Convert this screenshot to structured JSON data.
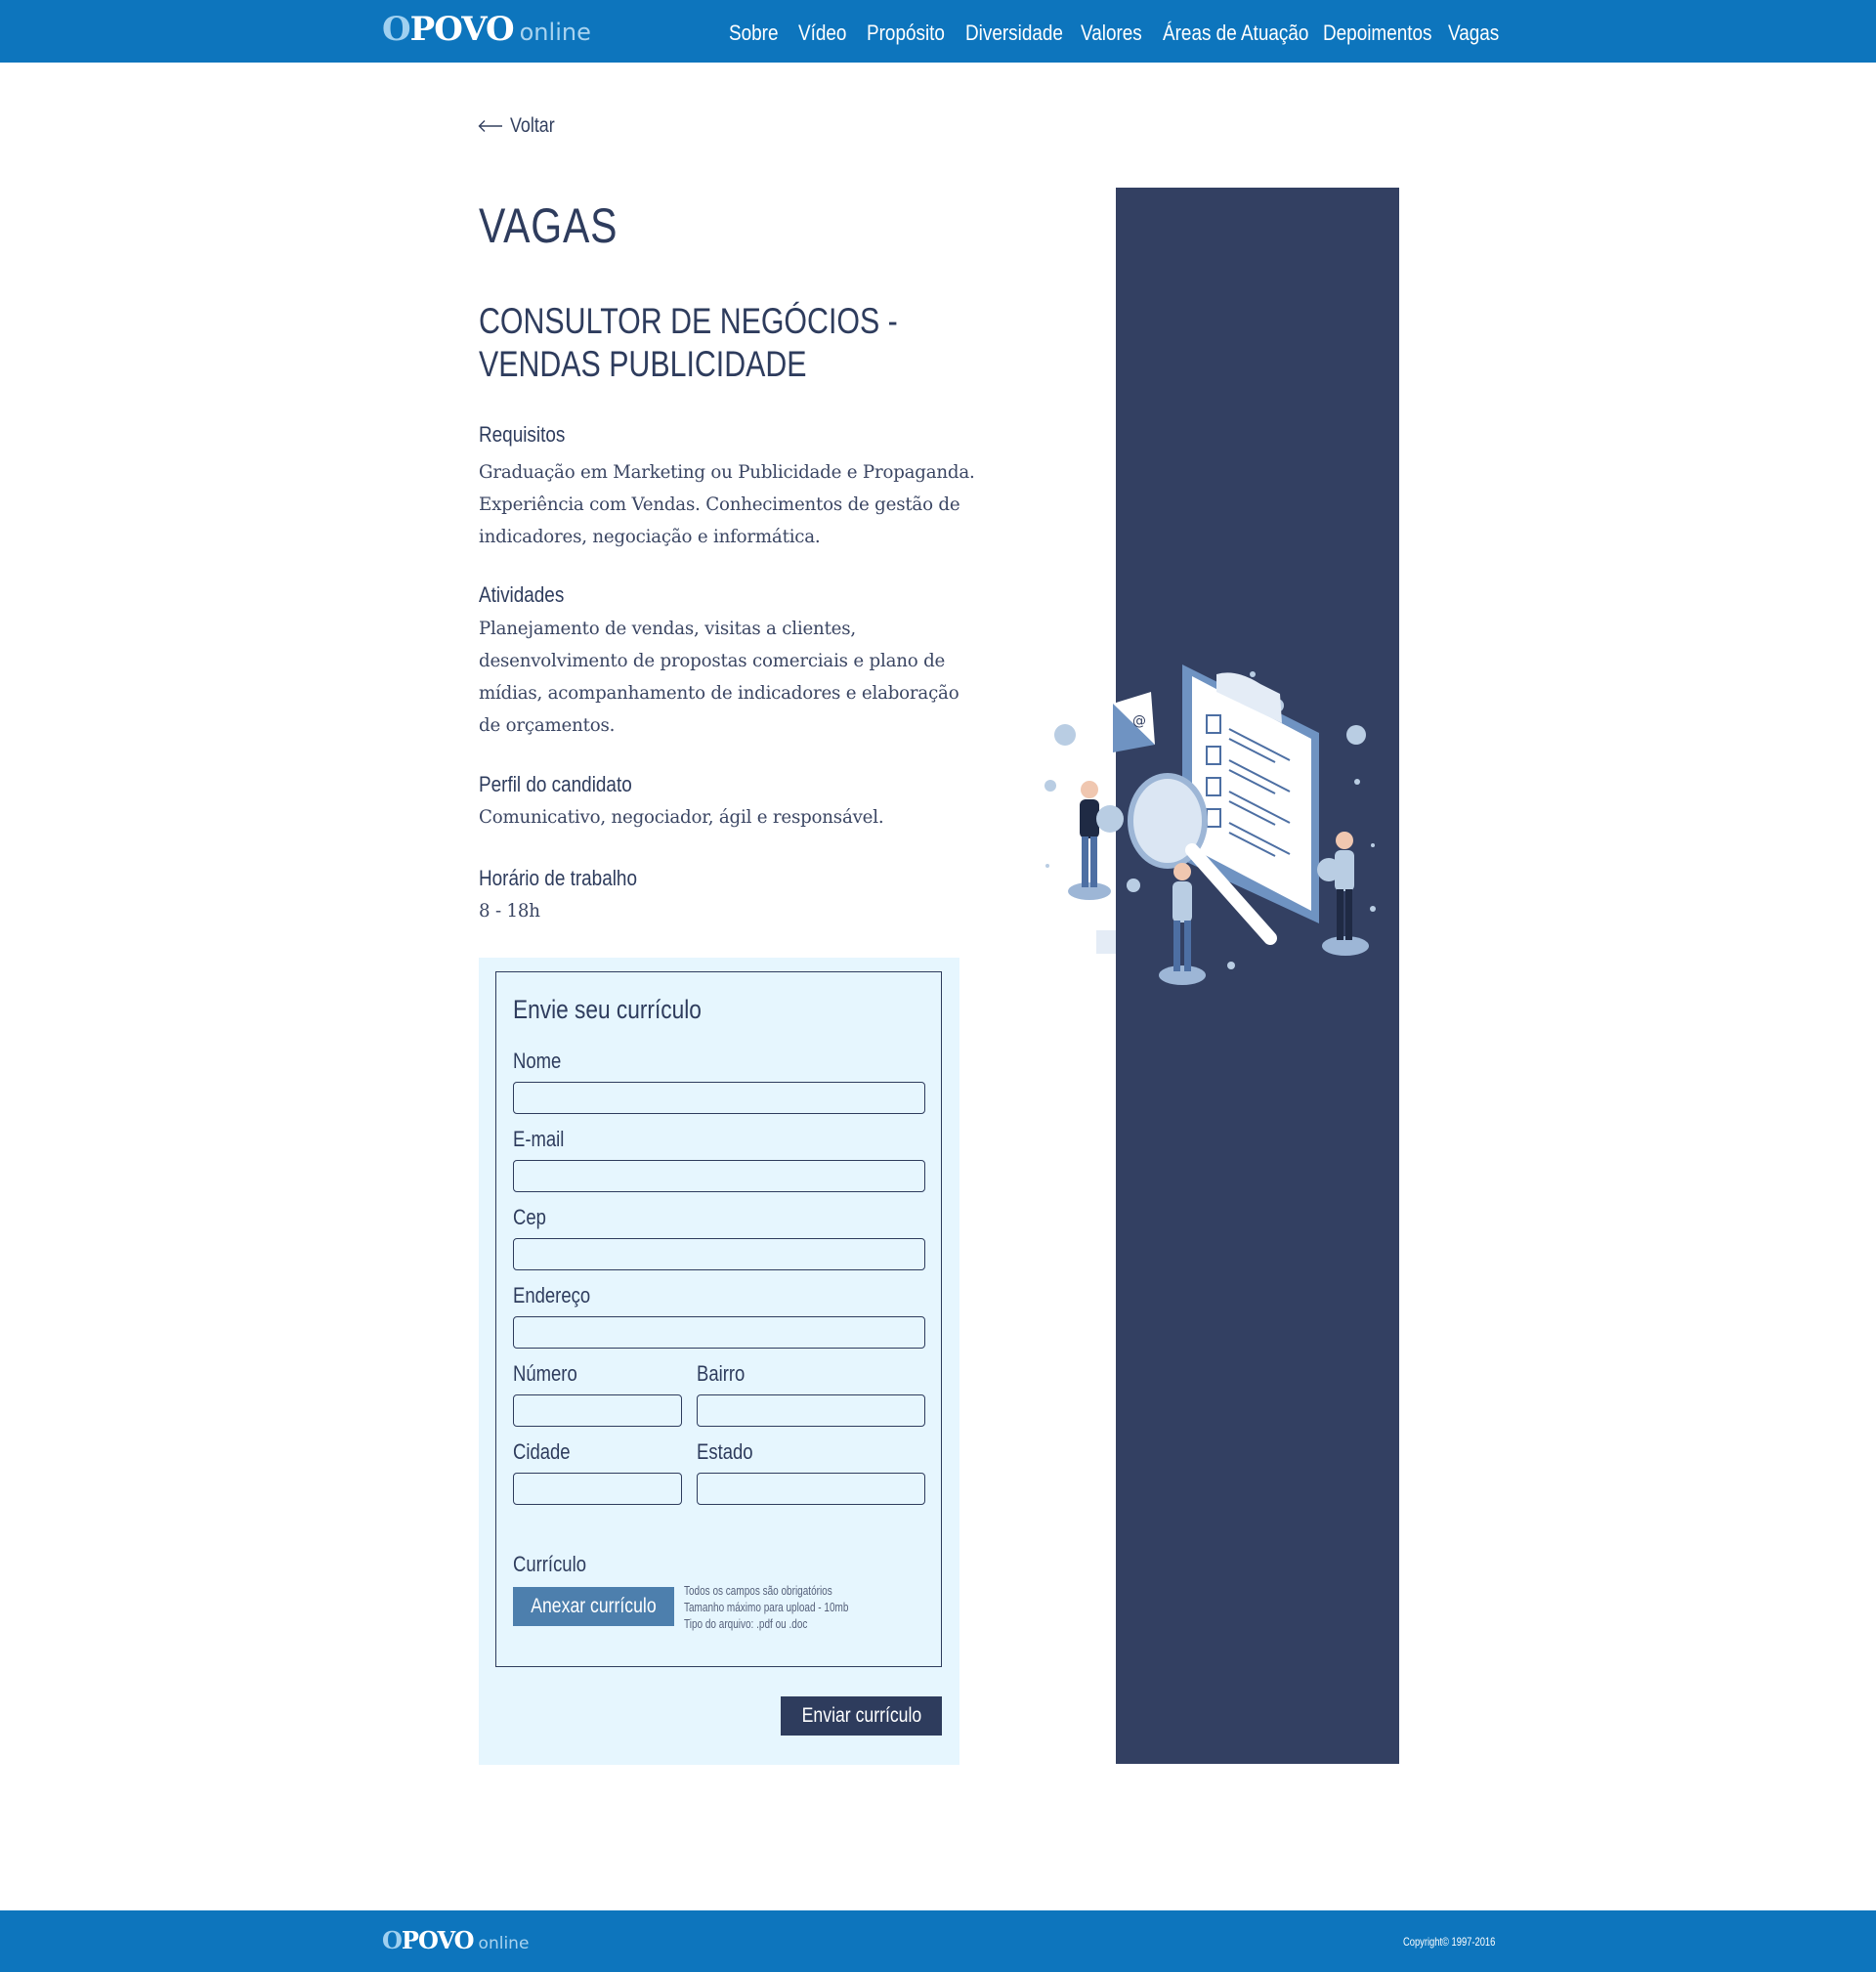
{
  "brand": {
    "logo_main_first": "O",
    "logo_main_rest": "POVO",
    "logo_sub": "online",
    "color_primary": "#0d75bd",
    "color_dark": "#334062"
  },
  "nav": {
    "items": [
      {
        "label": "Sobre"
      },
      {
        "label": "Vídeo"
      },
      {
        "label": "Propósito"
      },
      {
        "label": "Diversidade"
      },
      {
        "label": "Valores"
      },
      {
        "label": "Áreas de Atuação"
      },
      {
        "label": "Depoimentos"
      },
      {
        "label": "Vagas"
      }
    ]
  },
  "back": {
    "label": "Voltar",
    "icon": "arrow-left-icon"
  },
  "page": {
    "title": "VAGAS",
    "job_title": "CONSULTOR DE NEGÓCIOS - VENDAS PUBLICIDADE"
  },
  "sections": {
    "requisitos": {
      "heading": "Requisitos",
      "text": "Graduação em Marketing ou Publicidade e Propaganda. Experiência com Vendas. Conhecimentos de gestão de indicadores, negociação e informática."
    },
    "atividades": {
      "heading": "Atividades",
      "text": "Planejamento de vendas, visitas a clientes, desenvolvimento de propostas comerciais e plano de mídias, acompanhamento de indicadores e elaboração de orçamentos."
    },
    "perfil": {
      "heading": "Perfil do candidato",
      "text": "Comunicativo, negociador, ágil e responsável."
    },
    "horario": {
      "heading": "Horário de trabalho",
      "text": "8 - 18h"
    }
  },
  "form": {
    "title": "Envie seu currículo",
    "fields": {
      "nome": {
        "label": "Nome",
        "value": ""
      },
      "email": {
        "label": "E-mail",
        "value": ""
      },
      "cep": {
        "label": "Cep",
        "value": ""
      },
      "endereco": {
        "label": "Endereço",
        "value": ""
      },
      "numero": {
        "label": "Número",
        "value": ""
      },
      "bairro": {
        "label": "Bairro",
        "value": ""
      },
      "cidade": {
        "label": "Cidade",
        "value": ""
      },
      "estado": {
        "label": "Estado",
        "value": ""
      }
    },
    "curriculo_label": "Currículo",
    "attach_button": "Anexar currículo",
    "notes": [
      "Todos os campos são obrigatórios",
      "Tamanho máximo para upload - 10mb",
      "Tipo do arquivo: .pdf ou .doc"
    ],
    "submit_button": "Enviar currículo"
  },
  "footer": {
    "copyright": "Copyright© 1997-2016"
  }
}
